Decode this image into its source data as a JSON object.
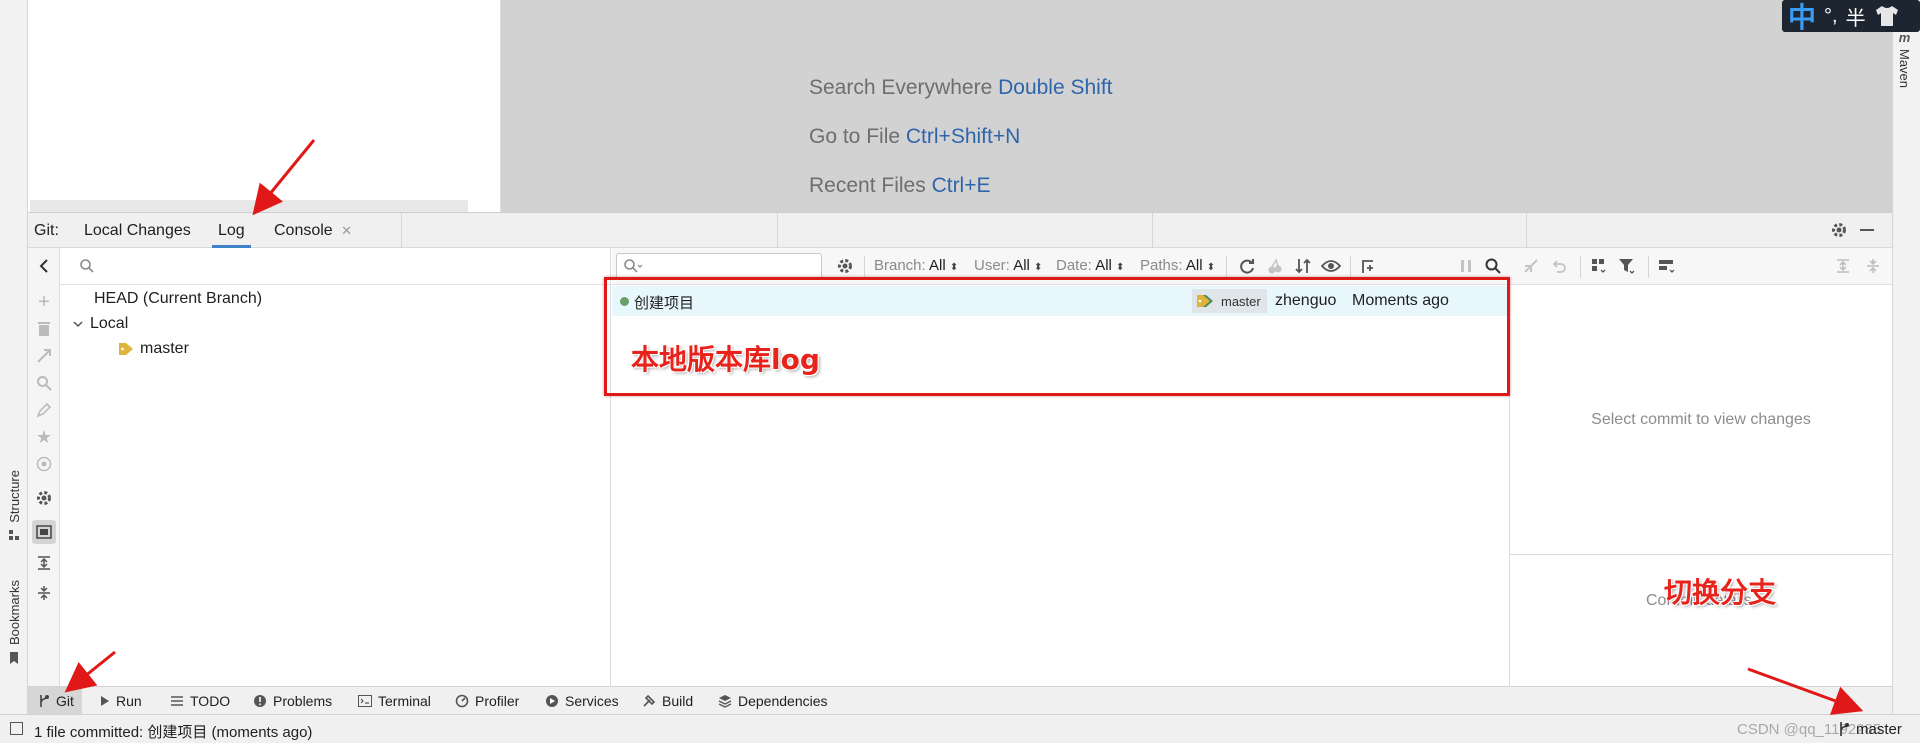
{
  "ime": {
    "mode": "中",
    "punct": "°,",
    "width": "半",
    "icon": "shirt-icon"
  },
  "left_stripe": {
    "structure": "Structure",
    "bookmarks": "Bookmarks"
  },
  "right_stripe": {
    "maven": "Maven"
  },
  "editor_hints": [
    {
      "text": "Search Everywhere",
      "key": "Double Shift"
    },
    {
      "text": "Go to File",
      "key": "Ctrl+Shift+N"
    },
    {
      "text": "Recent Files",
      "key": "Ctrl+E"
    }
  ],
  "git_window": {
    "prefix": "Git:",
    "tabs": [
      "Local Changes",
      "Log",
      "Console"
    ],
    "active_tab": "Log"
  },
  "branches": {
    "head": "HEAD (Current Branch)",
    "local": "Local",
    "master": "master"
  },
  "log_filters": {
    "branch_label": "Branch:",
    "branch_value": "All",
    "user_label": "User:",
    "user_value": "All",
    "date_label": "Date:",
    "date_value": "All",
    "paths_label": "Paths:",
    "paths_value": "All"
  },
  "commits": [
    {
      "message": "创建项目",
      "ref": "master",
      "author": "zhenguo",
      "date": "Moments ago"
    }
  ],
  "details": {
    "placeholder": "Select commit to view changes",
    "details_partial": "Commit details"
  },
  "tool_tabs": [
    "Git",
    "Run",
    "TODO",
    "Problems",
    "Terminal",
    "Profiler",
    "Services",
    "Build",
    "Dependencies"
  ],
  "status": {
    "message": "1 file committed: 创建项目 (moments ago)",
    "watermark": "CSDN @qq_1192285",
    "branch": "master"
  },
  "annotations": {
    "log_label": "本地版本库log",
    "switch_branch": "切换分支"
  },
  "colors": {
    "accent": "#4083c9",
    "annotation_red": "#e01818",
    "commit_dot": "#6a9f6a",
    "selected_row": "#e8f7fb",
    "tag": "#e0b43c"
  }
}
